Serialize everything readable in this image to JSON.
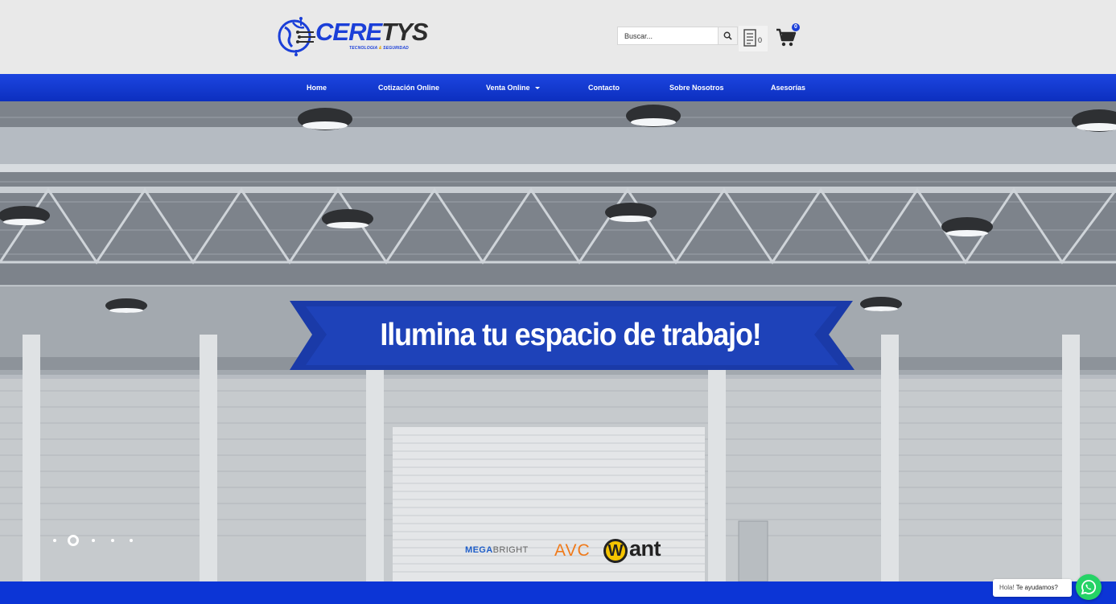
{
  "brand": {
    "logo_part1": "CERE",
    "logo_part2": "TYS",
    "tagline_part1": "TECNOLOGIA",
    "tagline_amp": "&",
    "tagline_part2": "SEGURIDAD"
  },
  "header": {
    "search": {
      "placeholder": "Buscar...",
      "value": ""
    },
    "quote_count": "0",
    "cart_count": "0"
  },
  "nav": {
    "items": [
      {
        "label": "Home"
      },
      {
        "label": "Cotización Online"
      },
      {
        "label": "Venta Online",
        "has_dropdown": true
      },
      {
        "label": "Contacto"
      },
      {
        "label": "Sobre Nosotros"
      },
      {
        "label": "Asesorías"
      }
    ]
  },
  "hero": {
    "headline": "Ilumina tu espacio de trabajo!",
    "slider": {
      "total": 5,
      "active": 2
    },
    "brands": {
      "mega_part1": "MEGA",
      "mega_part2": "BRIGHT",
      "avc": "AVC",
      "want_w": "W",
      "want_ant": "ant"
    }
  },
  "whatsapp": {
    "greeting": "Hola!",
    "prompt": "Te ayudamos?"
  },
  "colors": {
    "primary_blue": "#1c45e0",
    "banner_blue": "#1a3aa8",
    "whatsapp_green": "#25d366"
  },
  "icons": [
    "globe-circuit-logo-icon",
    "search-icon",
    "quote-list-icon",
    "cart-icon",
    "whatsapp-icon",
    "caret-down-icon"
  ]
}
